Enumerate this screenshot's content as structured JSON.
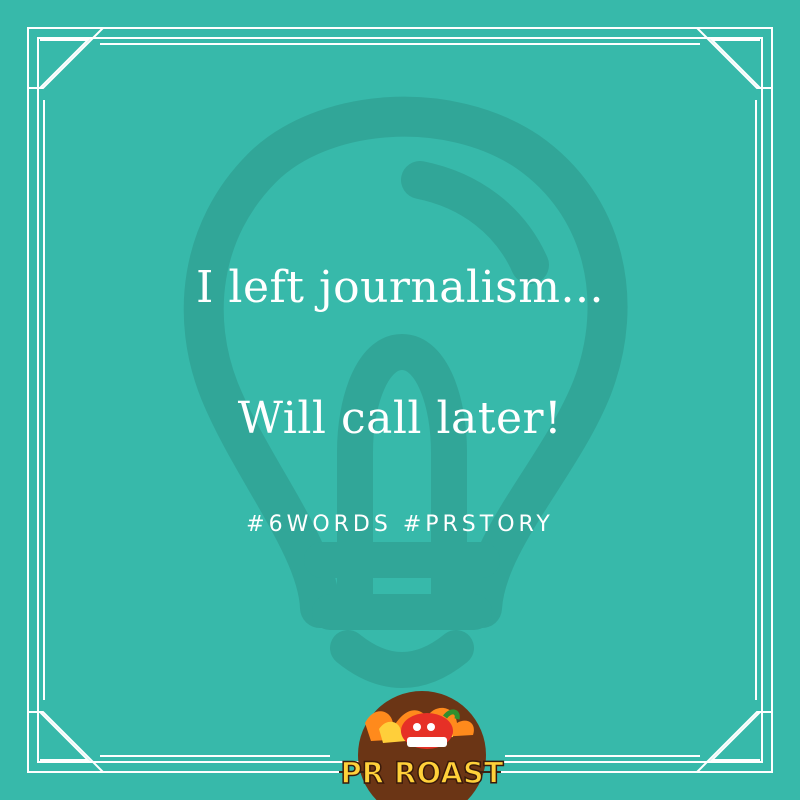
{
  "post": {
    "line_1": "I left journalism...",
    "line_2": "Will call later!",
    "hashtags": "#6WORDS #PRSTORY"
  },
  "logo": {
    "text": "PR ROAST",
    "icon": "chili-pepper-mascot-icon"
  },
  "background_icon": "lightbulb-icon",
  "colors": {
    "background": "#37b9aa",
    "text": "#ffffff",
    "frame": "#ffffff",
    "logo_brown": "#6b3515",
    "logo_yellow": "#ffd13a",
    "logo_red": "#e63026"
  }
}
